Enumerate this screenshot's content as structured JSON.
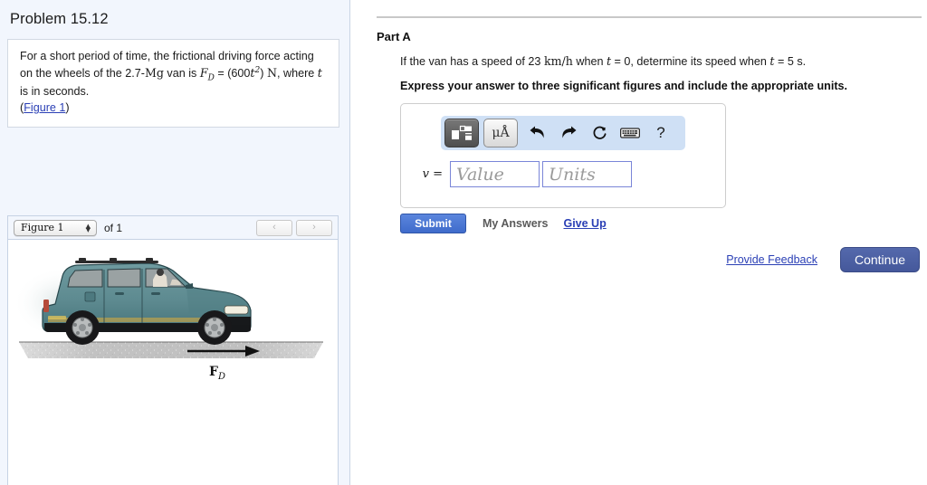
{
  "problem": {
    "title": "Problem 15.12",
    "statement_prefix": "For a short period of time, the frictional driving force acting on the wheels of the 2.7-",
    "mass_unit": "Mg",
    "statement_mid": " van is ",
    "force_symbol": "F",
    "force_sub": "D",
    "equals": " = (600",
    "t_var": "t",
    "t_exp": "2",
    "close_paren": ")",
    "unit_n": "N",
    "statement_suffix": ", where ",
    "t_var2": "t",
    "statement_end": " is in seconds.",
    "figure_link_open": "(",
    "figure_link": "Figure 1",
    "figure_link_close": ")"
  },
  "figure": {
    "selector_value": "Figure 1",
    "stepper_up": "▲",
    "stepper_down": "▼",
    "of_text": "of 1",
    "prev_label": "‹",
    "next_label": "›",
    "force_label_symbol": "F",
    "force_label_sub": "D",
    "alt": "Minivan on road with driving force F_D arrow pointing right",
    "van_body_color": "#5e8b90",
    "van_body_color_dark": "#3c6166",
    "road_color": "#c4c4c4"
  },
  "part": {
    "label": "Part A",
    "question_1": "If the van has a speed of 23 ",
    "speed_unit": "km/h",
    "question_2": " when ",
    "t_var": "t",
    "question_3": " = 0, determine its speed when ",
    "t_var2": "t",
    "question_4": " = 5 s.",
    "instruction": "Express your answer to three significant figures and include the appropriate units."
  },
  "toolbar": {
    "template_icon": "math-template-icon",
    "units_label": "μÅ",
    "undo_icon": "undo-icon",
    "redo_icon": "redo-icon",
    "reset_icon": "↻",
    "keyboard_icon": "keyboard-icon",
    "help_label": "?"
  },
  "answer": {
    "var_label": "v",
    "equals": "=",
    "value_placeholder": "Value",
    "value_text": "",
    "units_placeholder": "Units",
    "units_text": ""
  },
  "actions": {
    "submit_label": "Submit",
    "my_answers_label": "My Answers",
    "give_up_label": "Give Up",
    "provide_feedback_label": "Provide Feedback",
    "continue_label": "Continue"
  },
  "colors": {
    "submit_blue": "#4a77d4",
    "continue_blue": "#4d60a4",
    "link_blue": "#2a3fb5",
    "panel_bg": "#f2f6fd",
    "toolbar_bg": "#cfe0f5"
  }
}
